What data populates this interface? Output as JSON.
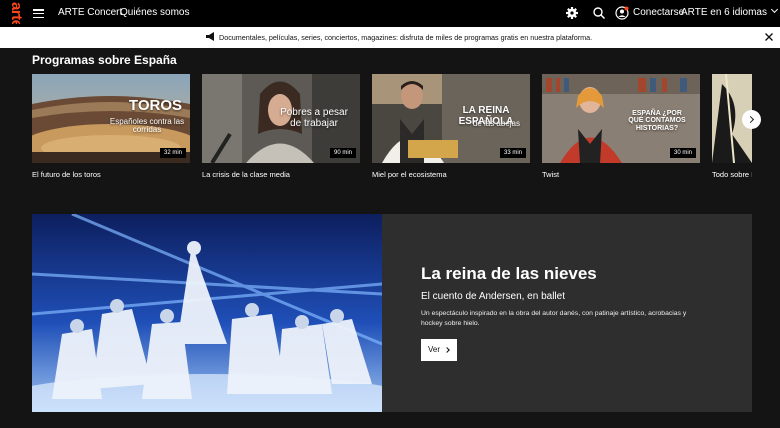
{
  "header": {
    "logo": "arte",
    "nav": [
      "ARTE Concert",
      "Quiénes somos"
    ],
    "login_label": "Conectarse",
    "language_label": "ARTE en 6 idiomas",
    "icons": [
      "menu-icon",
      "gear-icon",
      "search-icon",
      "user-icon",
      "chevron-down-icon"
    ]
  },
  "banner": {
    "text": "Documentales, películas, series, conciertos, magazines: disfruta de miles de programas gratis en nuestra plataforma."
  },
  "section": {
    "title": "Programas sobre España",
    "cards": [
      {
        "title": "El futuro de los toros",
        "duration": "32 min",
        "overlay_title": "TOROS",
        "overlay_sub": "Españoles contra las corridas"
      },
      {
        "title": "La crisis de la clase media",
        "duration": "90 min",
        "overlay_title": "Pobres a pesar de trabajar",
        "overlay_sub": ""
      },
      {
        "title": "Miel por el ecosistema",
        "duration": "33 min",
        "overlay_title": "LA REINA ESPAÑOLA",
        "overlay_sub": "de las abejas"
      },
      {
        "title": "Twist",
        "duration": "30 min",
        "overlay_title": "ESPAÑA ¿POR QUÉ CONTAMOS HISTORIAS?",
        "overlay_sub": ""
      },
      {
        "title": "Todo sobre B",
        "duration": "",
        "overlay_title": "",
        "overlay_sub": ""
      }
    ]
  },
  "featured": {
    "title": "La reina de las nieves",
    "subtitle": "El cuento de Andersen, en ballet",
    "description": "Un espectáculo inspirado en la obra del autor danés, con patinaje artístico, acrobacias y hockey sobre hielo.",
    "button_label": "Ver"
  },
  "colors": {
    "brand": "#fa481c",
    "background": "#141414",
    "panel": "#2e2e2e"
  }
}
